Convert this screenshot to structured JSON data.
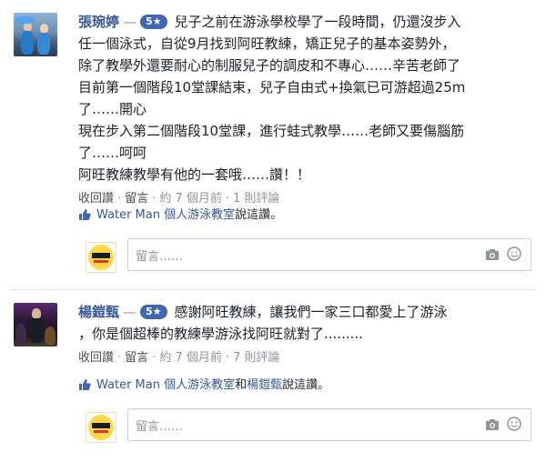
{
  "reviews": [
    {
      "author": "張琬婷",
      "dash": "—",
      "rating": "5★",
      "text": "兒子之前在游泳學校學了一段時間，仍還沒步入\n任一個泳式，自從9月找到阿旺教練，矯正兒子的基本姿勢外，\n除了教學外還要耐心的制服兒子的調皮和不專心……辛苦老師了\n目前第一個階段10堂課結束，兒子自由式+換氣已可游超過25m\n了……開心\n現在步入第二個階段10堂課，進行蛙式教學……老師又要傷腦筋\n了……呵呵\n阿旺教練教學有他的一套哦……讚！！",
      "actions": {
        "reply": "收回讚",
        "comment": "留言",
        "time": "約 7 個月前",
        "count": "1 則評論"
      },
      "likes": {
        "page": "Water Man 個人游泳教室",
        "suffix": "說這讚。"
      },
      "reply_placeholder": "留言……"
    },
    {
      "author": "楊鎧甄",
      "dash": "—",
      "rating": "5★",
      "text": "感謝阿旺教練，讓我們一家三口都愛上了游泳\n，你是個超棒的教練學游泳找阿旺就對了.........",
      "actions": {
        "reply": "收回讚",
        "comment": "留言",
        "time": "約 7 個月前",
        "count": "7 則評論"
      },
      "likes": {
        "page": "Water Man 個人游泳教室",
        "and": "和",
        "person": "楊鎧甄",
        "suffix": "說這讚。"
      },
      "reply_placeholder": "留言……"
    }
  ],
  "colors": {
    "link": "#365899",
    "rating_bg": "#4267b2",
    "muted": "#90949c"
  }
}
